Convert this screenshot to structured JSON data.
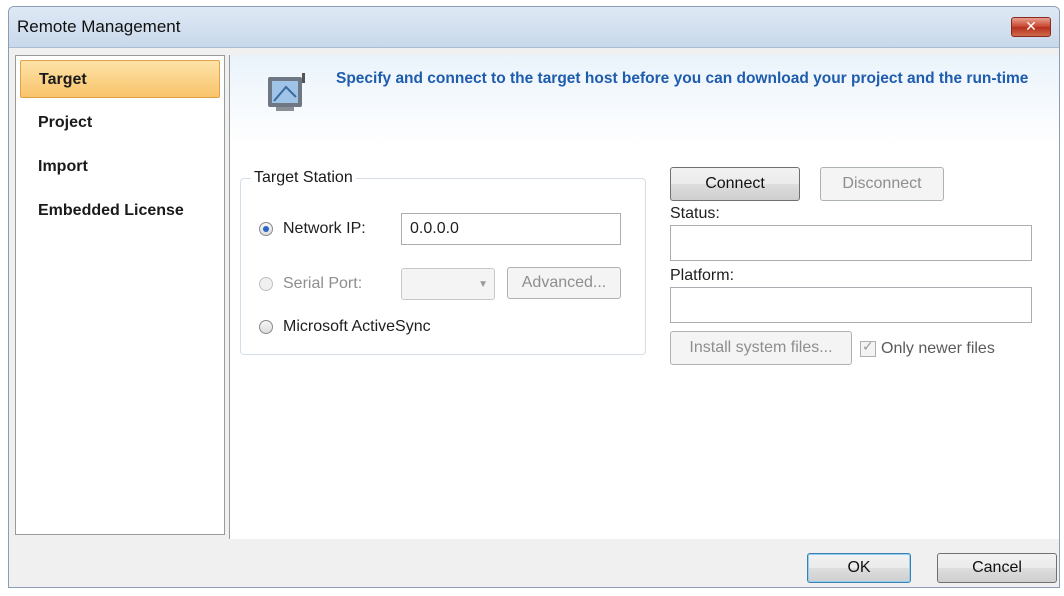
{
  "window": {
    "title": "Remote Management",
    "close_glyph": "✕"
  },
  "sidebar": {
    "items": [
      {
        "label": "Target",
        "active": true
      },
      {
        "label": "Project"
      },
      {
        "label": "Import"
      },
      {
        "label": "Embedded License"
      }
    ]
  },
  "banner": {
    "icon": "monitor-icon",
    "text": "Specify and connect to the target host before you can download your project and the run-time"
  },
  "target_station": {
    "legend": "Target Station",
    "network_ip": {
      "label": "Network IP:",
      "value": "0.0.0.0",
      "checked": true
    },
    "serial_port": {
      "label": "Serial Port:",
      "value": "",
      "advanced_label": "Advanced...",
      "enabled": false
    },
    "activesync": {
      "label": "Microsoft ActiveSync",
      "checked": false
    }
  },
  "connection": {
    "connect_label": "Connect",
    "disconnect_label": "Disconnect",
    "status_label": "Status:",
    "status_value": "",
    "platform_label": "Platform:",
    "platform_value": "",
    "install_label": "Install system files...",
    "only_newer_label": "Only newer files",
    "only_newer_checked": true
  },
  "footer": {
    "ok_label": "OK",
    "cancel_label": "Cancel"
  },
  "colors": {
    "accent_text": "#1e5cad",
    "selection": "#f9c36a"
  }
}
